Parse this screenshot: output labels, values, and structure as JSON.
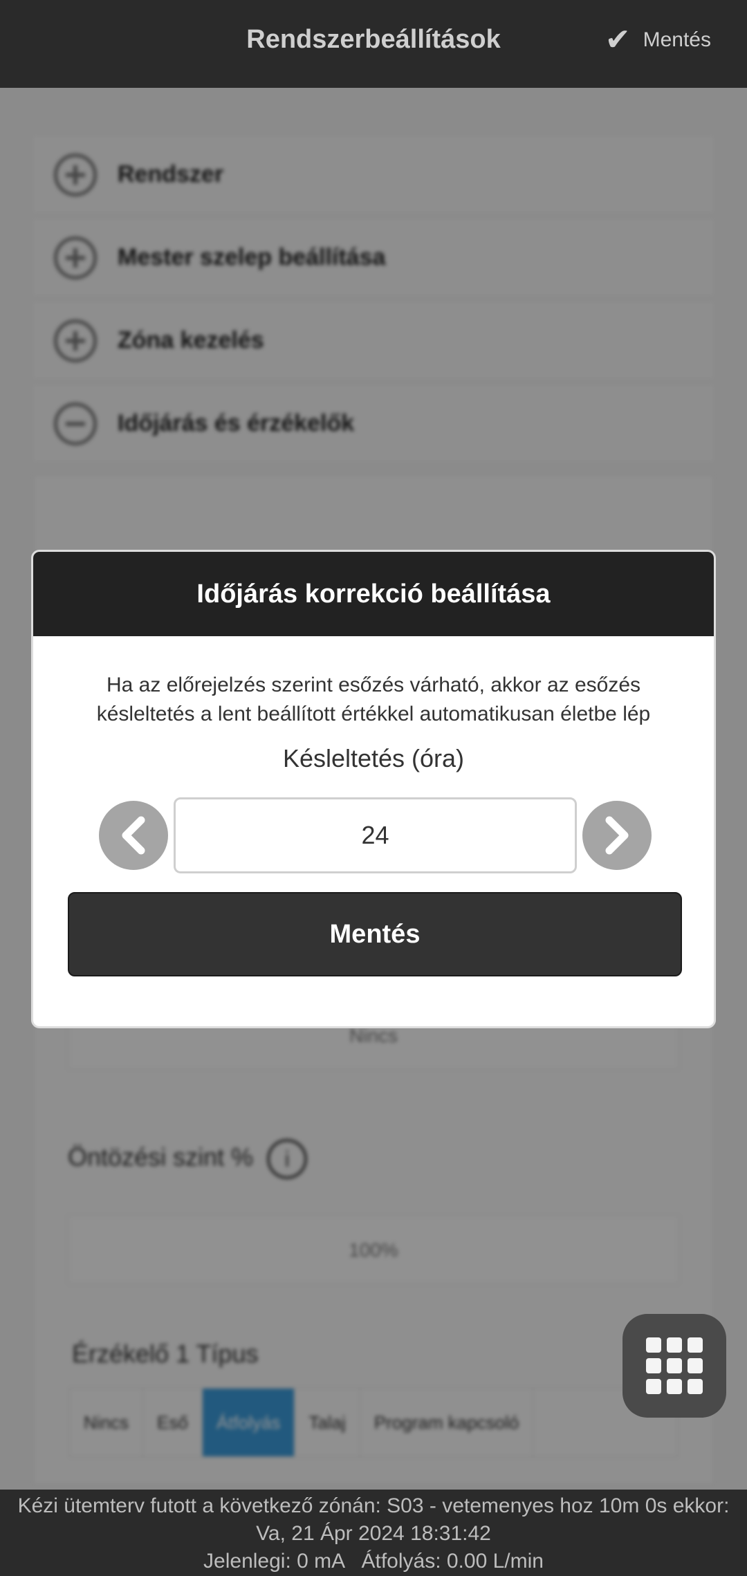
{
  "header": {
    "title": "Rendszerbeállítások",
    "save_label": "Mentés",
    "save_icon": "check-icon"
  },
  "background": {
    "sections": [
      {
        "label": "Rendszer",
        "icon": "plus-circle-icon"
      },
      {
        "label": "Mester szelep beállítása",
        "icon": "plus-circle-icon"
      },
      {
        "label": "Zóna kezelés",
        "icon": "plus-circle-icon"
      },
      {
        "label": "Időjárás és érzékelők",
        "icon": "minus-circle-icon"
      }
    ],
    "watering_level_label": "Öntözési szint %",
    "watering_level_value": "100%",
    "sensor_label": "Érzékelő 1 Típus",
    "sensor_tabs": [
      "Nincs",
      "Eső",
      "Átfolyás",
      "Talaj",
      "Program kapcsoló"
    ],
    "sensor_active": "Átfolyás",
    "partial_value": "Nincs"
  },
  "modal": {
    "title": "Időjárás korrekció beállítása",
    "description": "Ha az előrejelzés szerint esőzés várható, akkor az esőzés késleltetés a lent beállított értékkel automatikusan életbe lép",
    "field_label": "Késleltetés (óra)",
    "value": "24",
    "save_label": "Mentés"
  },
  "footer": {
    "line1": "Kézi ütemterv futott a következő zónán: S03 - vetemenyes hoz 10m 0s ekkor:",
    "line2": "Va, 21 Ápr 2024 18:31:42",
    "line3": "Jelenlegi: 0 mA   Átfolyás: 0.00 L/min"
  },
  "colors": {
    "header_bg": "#2a2a2a",
    "modal_header_bg": "#222222",
    "save_button_bg": "#333333",
    "arrow_button_bg": "#a5a5a5",
    "active_tab": "#3b9ad9"
  }
}
